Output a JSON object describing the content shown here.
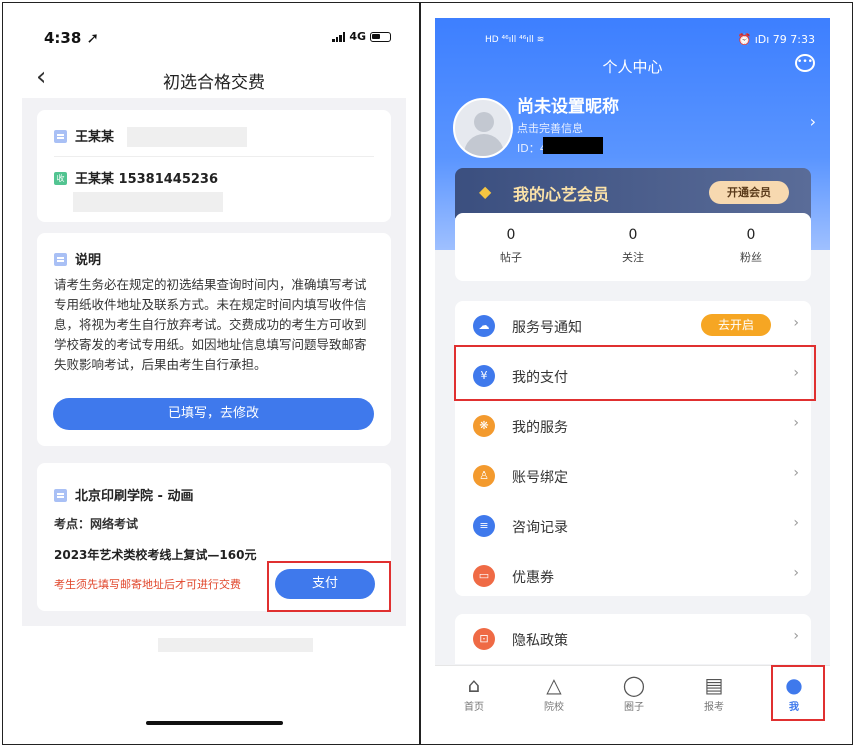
{
  "left": {
    "status": {
      "time": "4:38 ➚",
      "network": "4G"
    },
    "nav": {
      "back": "‹",
      "title": "初选合格交费"
    },
    "address": {
      "recipient_label": "王某某",
      "receiver_name_phone": "王某某  15381445236",
      "receiver_icon": "收"
    },
    "notice": {
      "title": "说明",
      "text": "请考生务必在规定的初选结果查询时间内，准确填写考试专用纸收件地址及联系方式。未在规定时间内填写收件信息，将视为考生自行放弃考试。交费成功的考生方可收到学校寄发的考试专用纸。如因地址信息填写问题导致邮寄失败影响考试，后果由考生自行承担。",
      "button": "已填写，去修改"
    },
    "exam": {
      "school": "北京印刷学院 - 动画",
      "venue": "考点：网络考试",
      "fee": "2023年艺术类校考线上复试—160元",
      "warning": "考生须先填写邮寄地址后才可进行交费",
      "pay_button": "支付"
    }
  },
  "right": {
    "status": {
      "left": "HD ⁴⁶ıll ⁴⁶ıll ≋",
      "right": "⏰ ıDı 79 7:33"
    },
    "title": "个人中心",
    "profile": {
      "nickname": "尚未设置昵称",
      "subtitle": "点击完善信息",
      "id_label": "ID：4"
    },
    "vip": {
      "title": "我的心艺会员",
      "button": "开通会员"
    },
    "stats": [
      {
        "value": "0",
        "label": "帖子"
      },
      {
        "value": "0",
        "label": "关注"
      },
      {
        "value": "0",
        "label": "粉丝"
      }
    ],
    "menu": [
      {
        "label": "服务号通知",
        "badge": "去开启",
        "color": "#3f79ec",
        "icon": "☁"
      },
      {
        "label": "我的支付",
        "color": "#3f79ec",
        "icon": "¥"
      },
      {
        "label": "我的服务",
        "color": "#f39a2e",
        "icon": "❋"
      },
      {
        "label": "账号绑定",
        "color": "#f39a2e",
        "icon": "♙"
      },
      {
        "label": "咨询记录",
        "color": "#3f79ec",
        "icon": "≡"
      },
      {
        "label": "优惠券",
        "color": "#ef6a45",
        "icon": "▭"
      }
    ],
    "privacy": {
      "label": "隐私政策",
      "color": "#ef6a45",
      "icon": "⊡"
    },
    "tabs": [
      {
        "label": "首页",
        "icon": "⌂"
      },
      {
        "label": "院校",
        "icon": "△"
      },
      {
        "label": "圈子",
        "icon": "◯"
      },
      {
        "label": "报考",
        "icon": "▤"
      },
      {
        "label": "我",
        "icon": "●"
      }
    ]
  }
}
